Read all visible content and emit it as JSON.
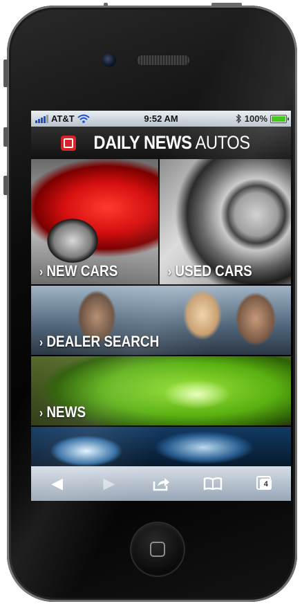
{
  "status_bar": {
    "carrier": "AT&T",
    "time": "9:52 AM",
    "battery": "100%",
    "battery_level": 1.0
  },
  "header": {
    "brand_bold": "DAILY NEWS",
    "brand_light": "AUTOS"
  },
  "tiles": [
    {
      "label": "NEW CARS"
    },
    {
      "label": "USED CARS"
    },
    {
      "label": "DEALER SEARCH"
    },
    {
      "label": "NEWS"
    }
  ],
  "toolbar": {
    "tabs_count": "4"
  },
  "icons": {
    "chevron": "›",
    "back": "◀",
    "forward": "▶"
  }
}
